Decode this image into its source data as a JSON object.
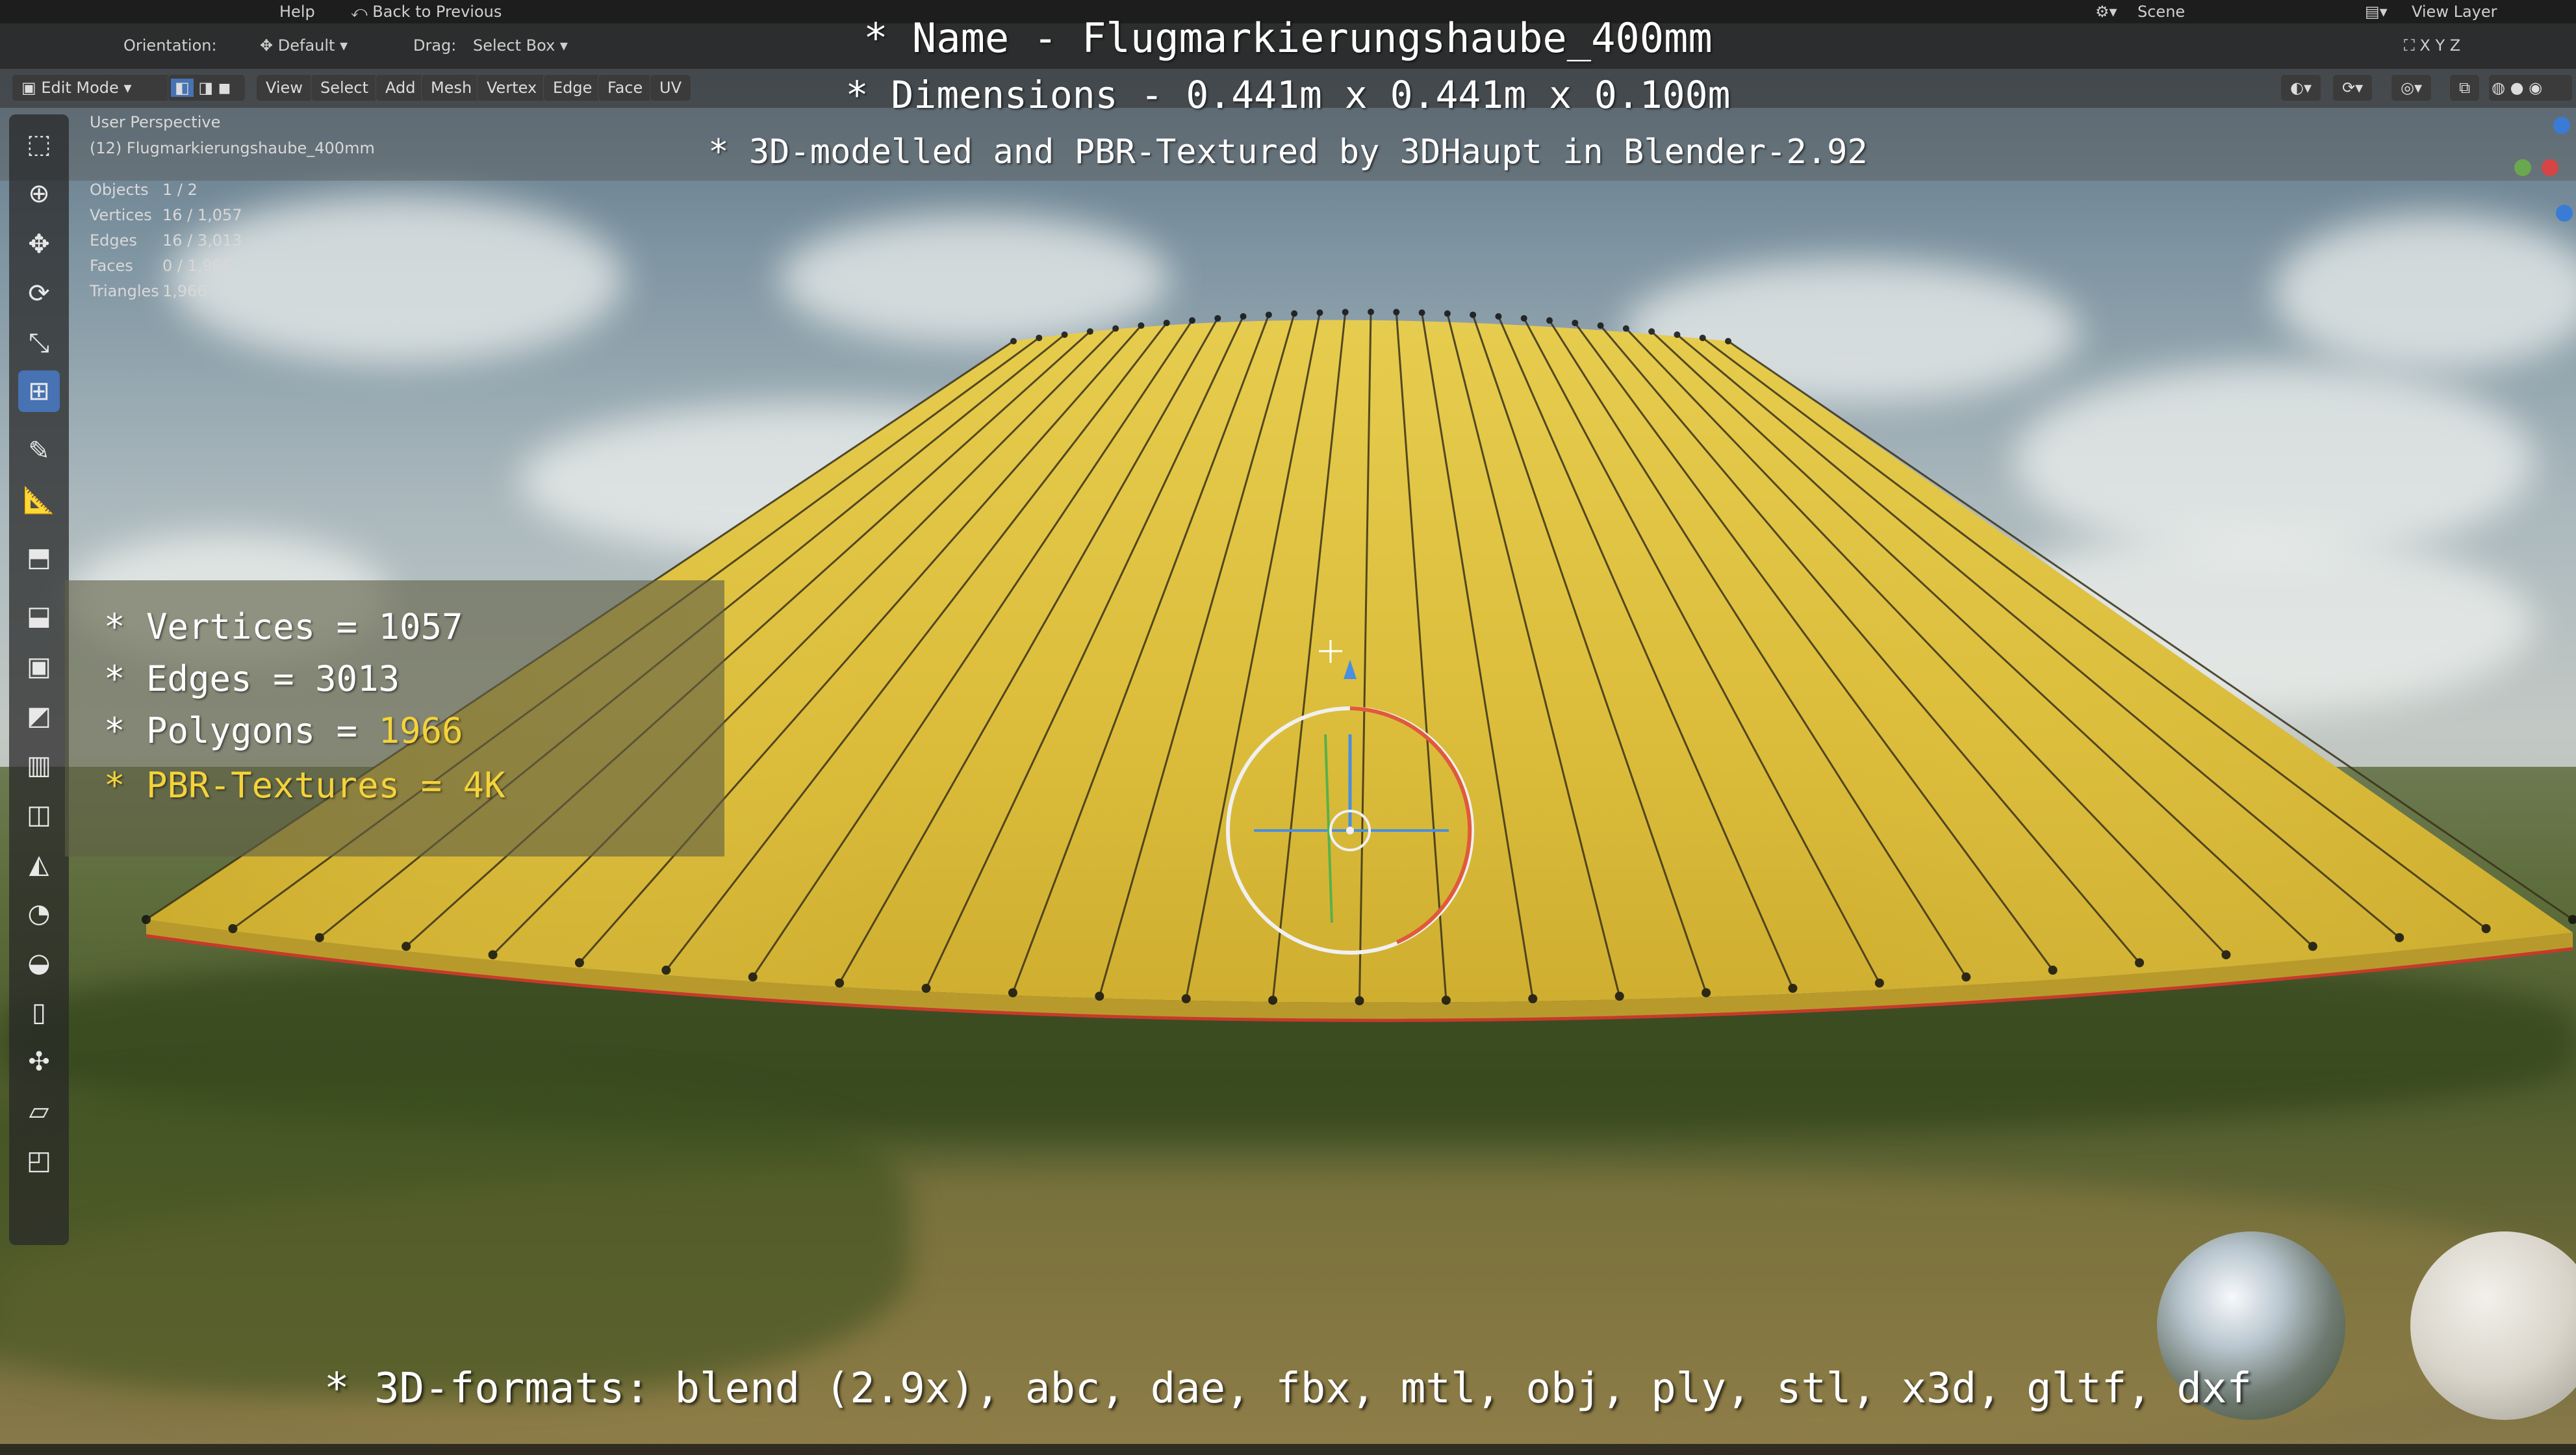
{
  "topbar": {
    "menu_help": "Help",
    "back_button": "Back to Previous",
    "scene_label": "Scene",
    "view_layer_label": "View Layer"
  },
  "headerbar": {
    "orientation_label": "Orientation:",
    "orientation_value": "Default",
    "drag_label": "Drag:",
    "drag_value": "Select Box"
  },
  "modebar": {
    "mode": "Edit Mode",
    "menus": [
      "View",
      "Select",
      "Add",
      "Mesh",
      "Vertex",
      "Edge",
      "Face",
      "UV"
    ]
  },
  "banner": {
    "name_line": "* Name - Flugmarkierungshaube_400mm",
    "dimensions_line": "* Dimensions -  0.441m x 0.441m x 0.100m",
    "credit_line": "* 3D-modelled and PBR-Textured by 3DHaupt in Blender-2.92"
  },
  "viewport": {
    "perspective": "User Perspective",
    "object_name": "(12) Flugmarkierungshaube_400mm",
    "stats": [
      {
        "label": "Objects",
        "value": "1 / 2"
      },
      {
        "label": "Vertices",
        "value": "16 / 1,057"
      },
      {
        "label": "Edges",
        "value": "16 / 3,013"
      },
      {
        "label": "Faces",
        "value": "0 / 1,966"
      },
      {
        "label": "Triangles",
        "value": "1,966"
      }
    ]
  },
  "statsbox": {
    "vertices": "* Vertices = 1057",
    "edges": "* Edges = 3013",
    "polygons_prefix": "* Polygons = ",
    "polygons_value": "1966",
    "pbr_textures": "* PBR-Textures = 4K"
  },
  "formats_line": "* 3D-formats: blend (2.9x), abc, dae, fbx, mtl, obj, ply, stl, x3d, gltf, dxf",
  "colors": {
    "cone_yellow": "#e0c13c",
    "accent_yellow": "#f4d33a",
    "active_tool_blue": "#4772b3",
    "edge_red": "#c73a2a"
  },
  "icons": [
    "select-box-icon",
    "cursor-icon",
    "move-icon",
    "rotate-icon",
    "scale-icon",
    "transform-icon",
    "annotate-icon",
    "measure-icon",
    "add-cube-icon",
    "extrude-icon",
    "inset-icon",
    "bevel-icon",
    "loop-cut-icon",
    "knife-icon",
    "poly-build-icon",
    "spin-icon",
    "smooth-icon",
    "edge-slide-icon",
    "shrink-fatten-icon",
    "shear-icon",
    "rip-icon"
  ]
}
